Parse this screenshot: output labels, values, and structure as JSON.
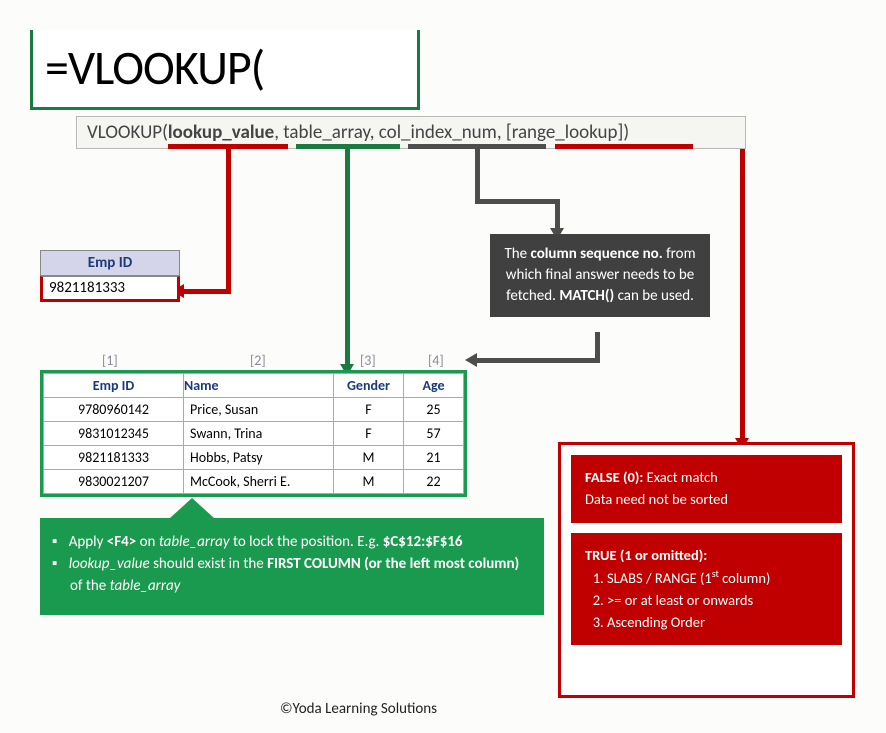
{
  "formula": "=VLOOKUP(",
  "tooltip": {
    "fn": "VLOOKUP(",
    "arg1": "lookup_value",
    "sep1": ", ",
    "arg2": "table_array",
    "sep2": ", ",
    "arg3": "col_index_num",
    "sep3": ", ",
    "arg4": "[range_lookup]",
    "close": ")"
  },
  "empid": {
    "header": "Emp ID",
    "value": "9821181333"
  },
  "colnums": {
    "c1": "[1]",
    "c2": "[2]",
    "c3": "[3]",
    "c4": "[4]"
  },
  "table": {
    "headers": {
      "c1": "Emp ID",
      "c2": "Name",
      "c3": "Gender",
      "c4": "Age"
    },
    "rows": [
      {
        "c1": "9780960142",
        "c2": "Price, Susan",
        "c3": "F",
        "c4": "25"
      },
      {
        "c1": "9831012345",
        "c2": "Swann, Trina",
        "c3": "F",
        "c4": "57"
      },
      {
        "c1": "9821181333",
        "c2": "Hobbs, Patsy",
        "c3": "M",
        "c4": "21"
      },
      {
        "c1": "9830021207",
        "c2": "McCook, Sherri E.",
        "c3": "M",
        "c4": "22"
      }
    ]
  },
  "green": {
    "l1a": "Apply ",
    "l1b": "<F4>",
    "l1c": " on ",
    "l1d": "table_array",
    "l1e": " to lock the position. E.g. ",
    "l1f": "$C$12:$F$16",
    "l2a": "lookup_value",
    "l2b": " should exist in the ",
    "l2c": "FIRST COLUMN (or the left most column)",
    "l2d": " of the ",
    "l2e": "table_array"
  },
  "gray": {
    "t1": "The ",
    "t2": "column sequence no.",
    "t3": " from which final answer needs to be fetched. ",
    "t4": "MATCH()",
    "t5": " can be used."
  },
  "red1": {
    "h": "FALSE (0):",
    "t1": " Exact match",
    "t2": "Data need not be sorted"
  },
  "red2": {
    "h": "TRUE (1 or omitted):",
    "li1a": "SLABS / RANGE (1",
    "li1b": "st",
    "li1c": " column)",
    "li2": ">= or at least or onwards",
    "li3": "Ascending Order"
  },
  "copyright": "©Yoda Learning Solutions"
}
